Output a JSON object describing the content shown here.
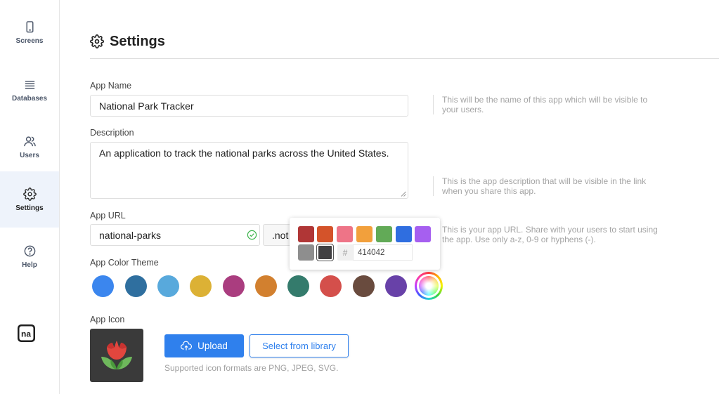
{
  "sidebar": {
    "items": [
      {
        "label": "Screens",
        "icon": "phone-icon"
      },
      {
        "label": "Databases",
        "icon": "database-icon"
      },
      {
        "label": "Users",
        "icon": "users-icon"
      },
      {
        "label": "Settings",
        "icon": "gear-icon",
        "active": true
      },
      {
        "label": "Help",
        "icon": "help-icon"
      }
    ],
    "brand_text": "na"
  },
  "header": {
    "title": "Settings",
    "icon": "gear-icon"
  },
  "app_name": {
    "label": "App Name",
    "value": "National Park Tracker",
    "help": "This will be the name of this app which will be visible to your users."
  },
  "description": {
    "label": "Description",
    "value": "An application to track the national parks across the United States.",
    "help": "This is the app description that will be visible in the link when you share this app."
  },
  "app_url": {
    "label": "App URL",
    "value": "national-parks",
    "domain_suffix": ".not",
    "help": "This is your app URL. Share with your users to start using the app. Use only a-z, 0-9 or hyphens (-)."
  },
  "color_theme": {
    "label": "App Color Theme",
    "presets": [
      "#3b86ee",
      "#2f6f9f",
      "#58a9dc",
      "#dcb135",
      "#aa3d7f",
      "#d2802f",
      "#347b6c",
      "#d44f4b",
      "#694b3e",
      "#6841a8"
    ],
    "popover": {
      "swatches": [
        "#b03636",
        "#d4532a",
        "#ee7487",
        "#f2a03c",
        "#62aa57",
        "#2f6ee0",
        "#a65ff0",
        "#8e8e8e",
        "#414042"
      ],
      "selected": "#414042",
      "hash_symbol": "#",
      "hex_value": "414042"
    }
  },
  "app_icon": {
    "label": "App Icon",
    "upload_label": "Upload",
    "library_label": "Select from library",
    "formats_note": "Supported icon formats are PNG, JPEG, SVG."
  },
  "colors": {
    "accent": "#2f80ed",
    "active_bg": "#eef3fb"
  }
}
